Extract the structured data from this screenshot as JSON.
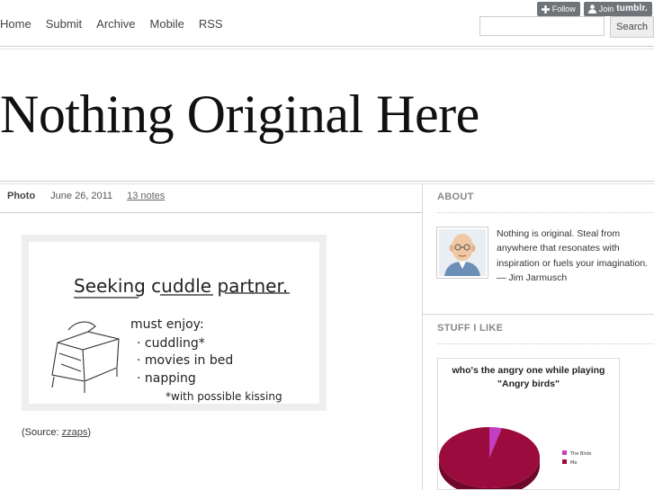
{
  "nav": [
    "Home",
    "Submit",
    "Archive",
    "Mobile",
    "RSS"
  ],
  "tumblr": {
    "follow": "Follow",
    "join": "Join",
    "brand": "tumblr."
  },
  "search": {
    "value": "",
    "button": "Search"
  },
  "site_title": "Nothing Original Here",
  "post": {
    "type": "Photo",
    "date": "June 26, 2011",
    "notes": "13 notes",
    "image_text": {
      "headline": "Seeking cuddle partner.",
      "must": "must enjoy:",
      "items": [
        "· cuddling*",
        "· movies in bed",
        "· napping"
      ],
      "footnote": "*with possible kissing"
    },
    "caption_prefix": "(Source: ",
    "caption_link": "zzaps",
    "caption_suffix": ")"
  },
  "sidebar": {
    "about_heading": "ABOUT",
    "about_text": "Nothing is original. Steal from anywhere that resonates with inspiration or fuels your imagination. — Jim Jarmusch",
    "stuff_heading": "STUFF I LIKE"
  },
  "chart_data": {
    "type": "pie",
    "title": "who's the angry one while playing \"Angry birds\"",
    "categories": [
      "The Birds",
      "Me"
    ],
    "values": [
      4,
      96
    ],
    "colors": [
      "#c43ec4",
      "#9b0b3d"
    ]
  }
}
